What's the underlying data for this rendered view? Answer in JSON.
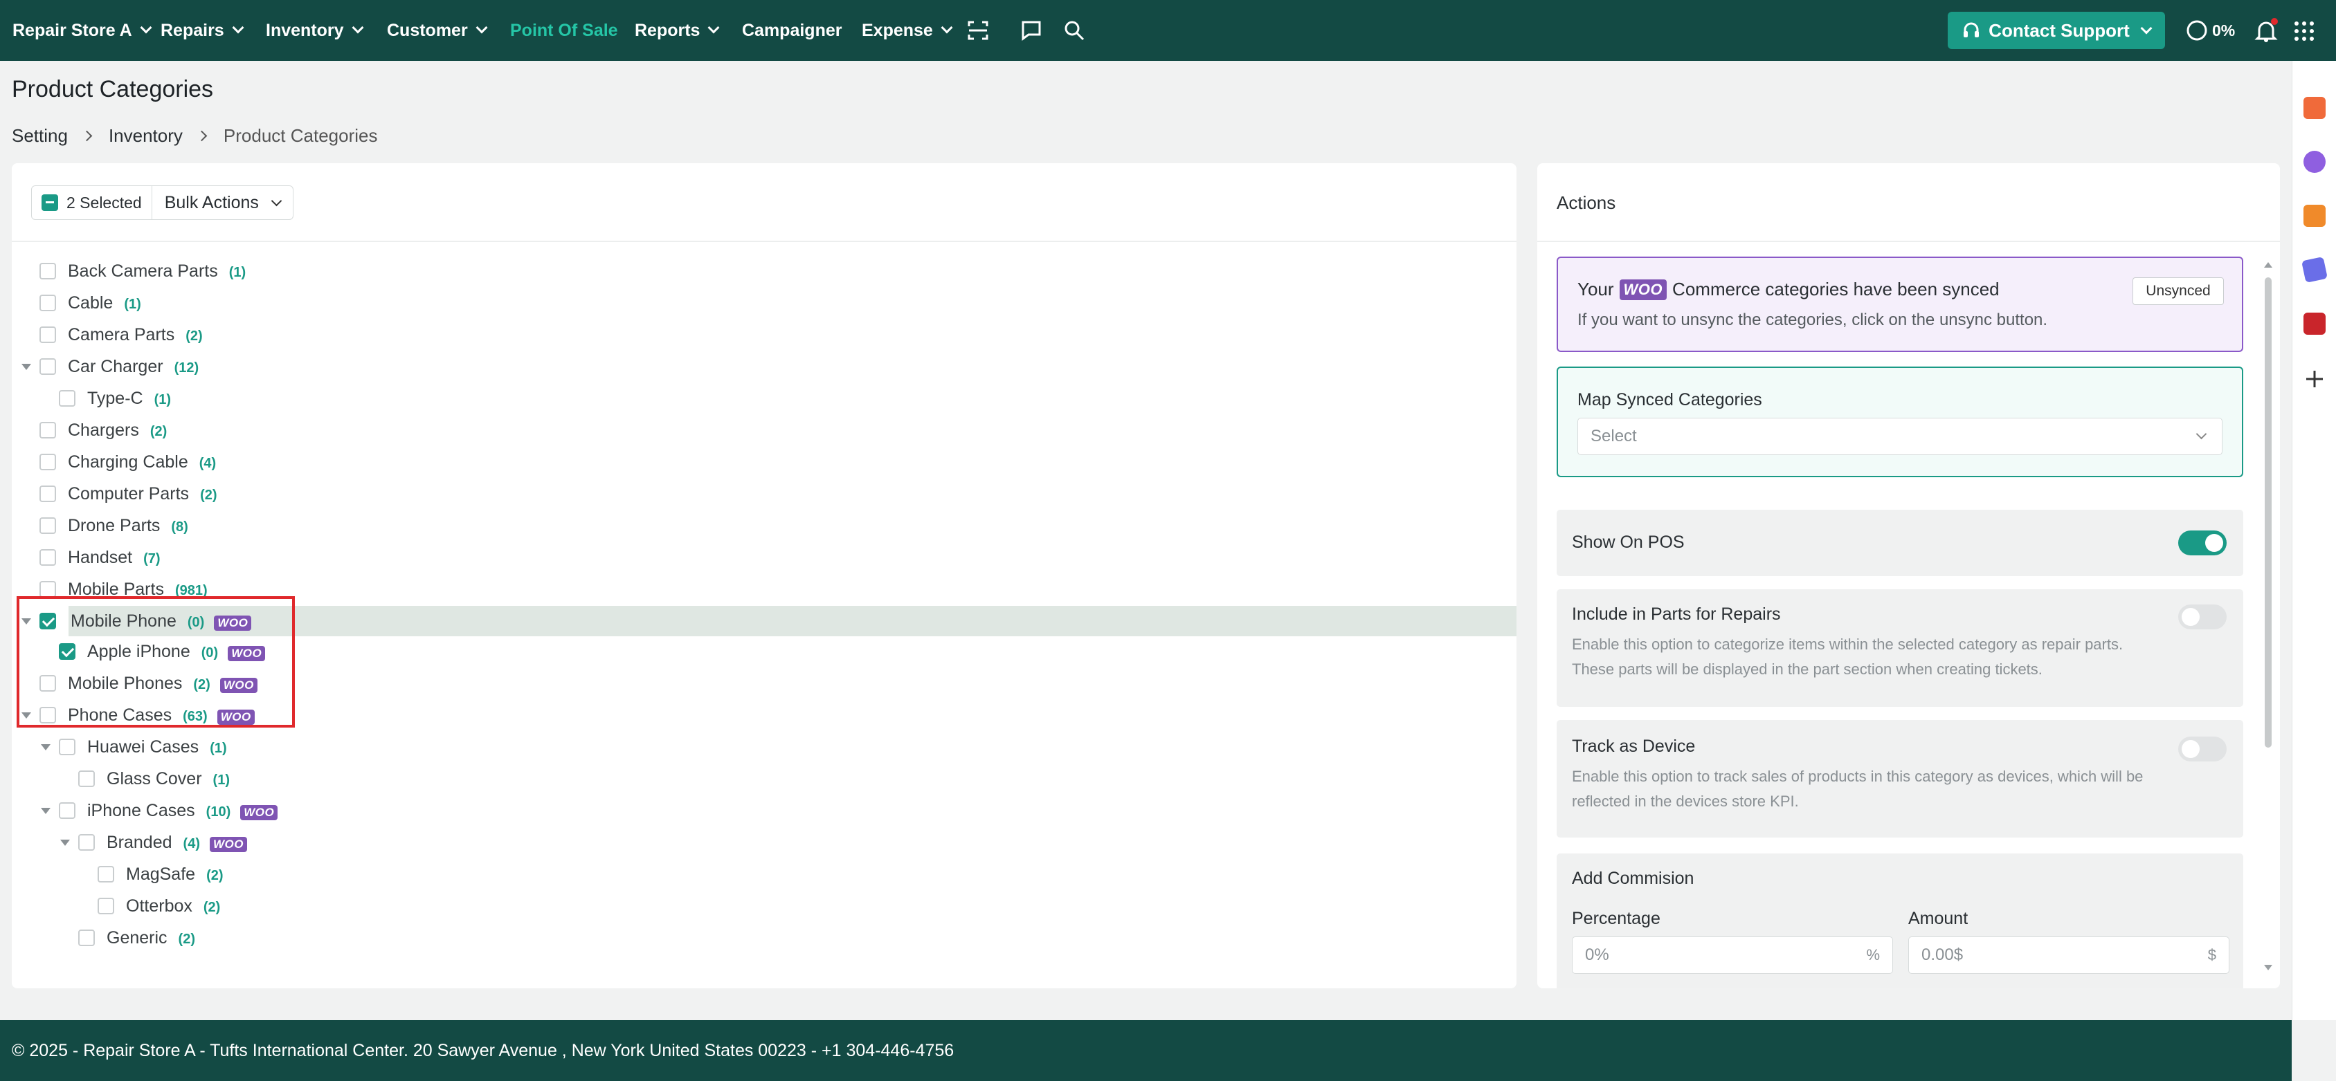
{
  "topnav": {
    "store": "Repair Store A",
    "items": [
      "Repairs",
      "Inventory",
      "Customer",
      "Point Of Sale",
      "Reports",
      "Campaigner",
      "Expense"
    ],
    "contact": "Contact Support",
    "progress": "0%"
  },
  "page": {
    "title": "Product Categories",
    "breadcrumb": [
      "Setting",
      "Inventory",
      "Product Categories"
    ]
  },
  "toolbar": {
    "selected": "2 Selected",
    "bulk": "Bulk Actions"
  },
  "categories": [
    {
      "name": "Back Camera Parts",
      "count": "(1)"
    },
    {
      "name": "Cable",
      "count": "(1)"
    },
    {
      "name": "Camera Parts",
      "count": "(2)"
    },
    {
      "name": "Car Charger",
      "count": "(12)"
    },
    {
      "name": "Type-C",
      "count": "(1)"
    },
    {
      "name": "Chargers",
      "count": "(2)"
    },
    {
      "name": "Charging Cable",
      "count": "(4)"
    },
    {
      "name": "Computer Parts",
      "count": "(2)"
    },
    {
      "name": "Drone Parts",
      "count": "(8)"
    },
    {
      "name": "Handset",
      "count": "(7)"
    },
    {
      "name": "Mobile Parts",
      "count": "(981)"
    },
    {
      "name": "Mobile Phone",
      "count": "(0)",
      "woo": "WOO"
    },
    {
      "name": "Apple iPhone",
      "count": "(0)",
      "woo": "WOO"
    },
    {
      "name": "Mobile Phones",
      "count": "(2)",
      "woo": "WOO"
    },
    {
      "name": "Phone Cases",
      "count": "(63)",
      "woo": "WOO"
    },
    {
      "name": "Huawei Cases",
      "count": "(1)"
    },
    {
      "name": "Glass Cover",
      "count": "(1)"
    },
    {
      "name": "iPhone Cases",
      "count": "(10)",
      "woo": "WOO"
    },
    {
      "name": "Branded",
      "count": "(4)",
      "woo": "WOO"
    },
    {
      "name": "MagSafe",
      "count": "(2)"
    },
    {
      "name": "Otterbox",
      "count": "(2)"
    },
    {
      "name": "Generic",
      "count": "(2)"
    }
  ],
  "actions": {
    "title": "Actions",
    "sync_title_pre": "Your",
    "sync_woo": "WOO",
    "sync_title_post": "Commerce categories have been synced",
    "sync_sub": "If you want to unsync the categories, click on the unsync button.",
    "unsync": "Unsynced",
    "map_title": "Map Synced Categories",
    "map_placeholder": "Select",
    "show_pos": "Show On POS",
    "include_title": "Include in Parts for Repairs",
    "include_desc": "Enable this option to categorize items within the selected category as repair parts. These parts will be displayed in the part section when creating tickets.",
    "track_title": "Track as Device",
    "track_desc": "Enable this option to track sales of products in this category as devices, which will be reflected in the devices store KPI.",
    "commission_title": "Add Commision",
    "percentage_label": "Percentage",
    "percentage_placeholder": "0%",
    "percentage_suffix": "%",
    "amount_label": "Amount",
    "amount_placeholder": "0.00$",
    "amount_suffix": "$"
  },
  "footer": {
    "text": "© 2025 - Repair Store A - Tufts International Center. 20 Sawyer Avenue , New York United States 00223 - +1 304-446-4756"
  },
  "colors": {
    "nav_bg": "#134a44",
    "accent": "#1a9a86",
    "woo": "#7f54b3",
    "highlight": "#e0292c"
  }
}
